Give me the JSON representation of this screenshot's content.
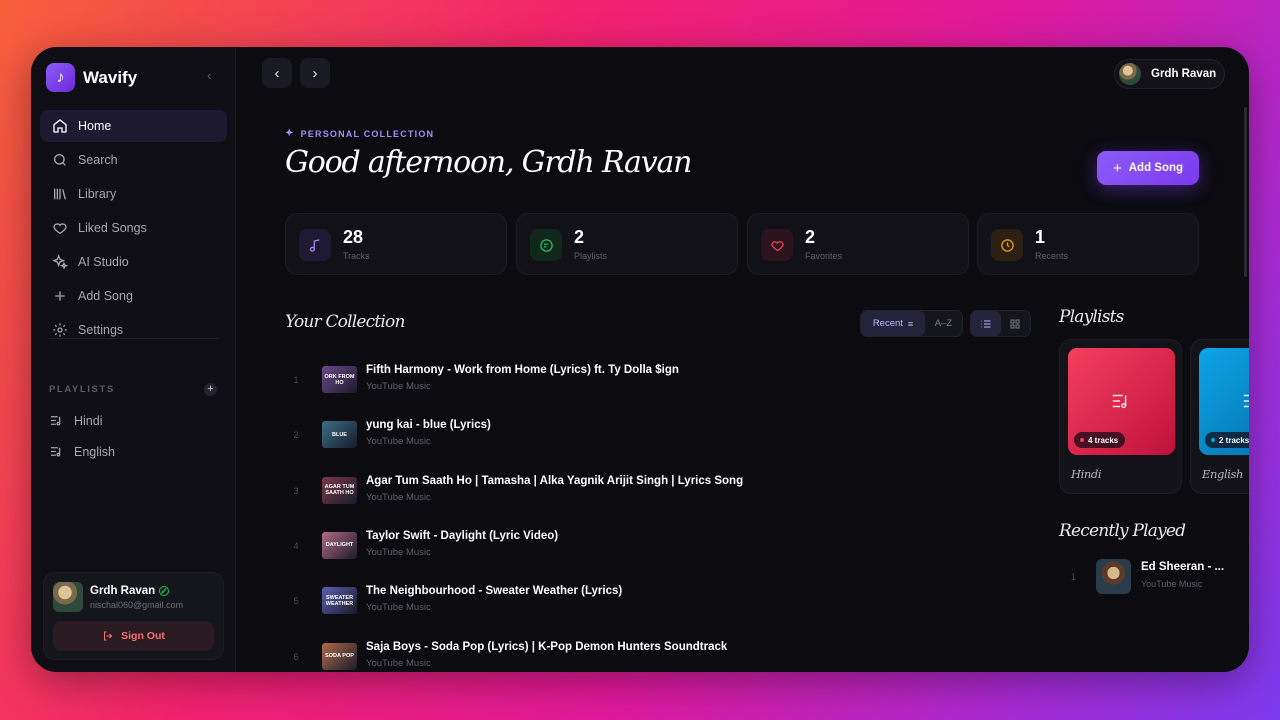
{
  "brand": {
    "name": "Wavify"
  },
  "sidebar": {
    "items": [
      {
        "label": "Home",
        "icon": "home-icon",
        "active": true
      },
      {
        "label": "Search",
        "icon": "search-icon"
      },
      {
        "label": "Library",
        "icon": "library-icon"
      },
      {
        "label": "Liked Songs",
        "icon": "heart-icon"
      },
      {
        "label": "AI Studio",
        "icon": "sparkles-icon"
      },
      {
        "label": "Add Song",
        "icon": "plus-icon"
      },
      {
        "label": "Settings",
        "icon": "gear-icon"
      }
    ],
    "playlists_title": "PLAYLISTS",
    "playlists": [
      {
        "label": "Hindi",
        "icon": "playlist-icon"
      },
      {
        "label": "English",
        "icon": "playlist-icon"
      }
    ]
  },
  "user": {
    "name": "Grdh Ravan",
    "email": "nischal060@gmail.com",
    "sign_out": "Sign Out"
  },
  "header": {
    "eyebrow": "PERSONAL COLLECTION",
    "greeting": "Good afternoon, Grdh Ravan",
    "add_song": "Add Song"
  },
  "stats": [
    {
      "value": "28",
      "label": "Tracks",
      "icon": "music-note-icon",
      "color": "#a78bfa"
    },
    {
      "value": "2",
      "label": "Playlists",
      "icon": "playlist-circle-icon",
      "color": "#22c55e"
    },
    {
      "value": "2",
      "label": "Favorites",
      "icon": "heart-icon",
      "color": "#f43f5e"
    },
    {
      "value": "1",
      "label": "Recents",
      "icon": "clock-icon",
      "color": "#f59e0b"
    }
  ],
  "collection": {
    "title": "Your Collection",
    "sort_recent": "Recent",
    "sort_az": "A–Z",
    "tracks": [
      {
        "num": "1",
        "title": "Fifth Harmony - Work from Home (Lyrics) ft. Ty Dolla $ign",
        "source": "YouTube Music",
        "thumb_text": "ORK FROM HO",
        "thumb_color": "#6b4a8a"
      },
      {
        "num": "2",
        "title": "yung kai - blue (Lyrics)",
        "source": "YouTube Music",
        "thumb_text": "BLUE",
        "thumb_color": "#3a6f88"
      },
      {
        "num": "3",
        "title": "Agar Tum Saath Ho | Tamasha | Alka Yagnik Arijit Singh | Lyrics Song",
        "source": "YouTube Music",
        "thumb_text": "AGAR TUM SAATH HO",
        "thumb_color": "#7a3a4a"
      },
      {
        "num": "4",
        "title": "Taylor Swift - Daylight (Lyric Video)",
        "source": "YouTube Music",
        "thumb_text": "DAYLIGHT",
        "thumb_color": "#b56a86"
      },
      {
        "num": "5",
        "title": "The Neighbourhood - Sweater Weather (Lyrics)",
        "source": "YouTube Music",
        "thumb_text": "SWEATER WEATHER",
        "thumb_color": "#5a5fb0"
      },
      {
        "num": "6",
        "title": "Saja Boys - Soda Pop (Lyrics) | K-Pop Demon Hunters Soundtrack",
        "source": "YouTube Music",
        "thumb_text": "SODA POP",
        "thumb_color": "#b06a4a"
      }
    ]
  },
  "playlists_panel": {
    "title": "Playlists",
    "cards": [
      {
        "name": "Hindi",
        "tracks": "4 tracks",
        "color": "#e11d48"
      },
      {
        "name": "English",
        "tracks": "2 tracks",
        "color": "#0ea5e9"
      }
    ]
  },
  "recently_played": {
    "title": "Recently Played",
    "items": [
      {
        "num": "1",
        "title": "Ed Sheeran - ...",
        "source": "YouTube Music"
      }
    ]
  }
}
